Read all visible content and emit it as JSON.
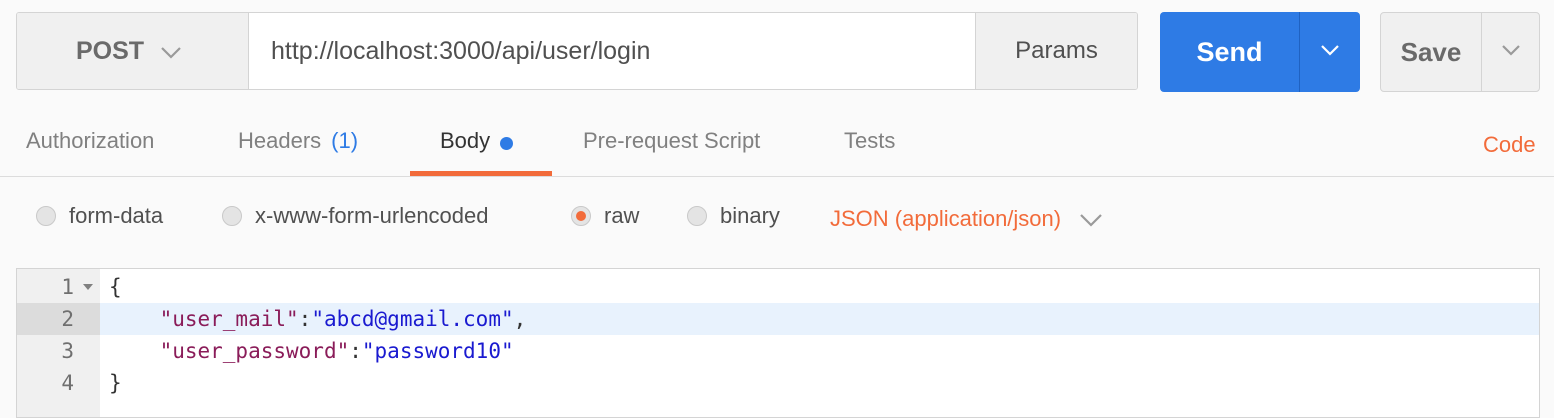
{
  "request": {
    "method": "POST",
    "url": "http://localhost:3000/api/user/login",
    "params_label": "Params",
    "send_label": "Send",
    "save_label": "Save"
  },
  "tabs": [
    {
      "label": "Authorization"
    },
    {
      "label": "Headers",
      "count": "(1)"
    },
    {
      "label": "Body",
      "active": true,
      "indicator": "blue-dot"
    },
    {
      "label": "Pre-request Script"
    },
    {
      "label": "Tests"
    }
  ],
  "code_link": "Code",
  "body_modes": [
    {
      "label": "form-data",
      "selected": false
    },
    {
      "label": "x-www-form-urlencoded",
      "selected": false
    },
    {
      "label": "raw",
      "selected": true
    },
    {
      "label": "binary",
      "selected": false
    }
  ],
  "content_type": "JSON (application/json)",
  "editor": {
    "active_line": 2,
    "lines": [
      {
        "num": "1",
        "open": "{"
      },
      {
        "num": "2",
        "indent": "    ",
        "key": "\"user_mail\"",
        "sep": ":",
        "value": "\"abcd@gmail.com\"",
        "trail": ","
      },
      {
        "num": "3",
        "indent": "    ",
        "key": "\"user_password\"",
        "sep": ":",
        "value": "\"password10\"",
        "trail": ""
      },
      {
        "num": "4",
        "close": "}"
      }
    ]
  },
  "colors": {
    "accent": "#f26b3a",
    "send_button": "#2e7be5",
    "json_key": "#8a1c59",
    "json_string": "#1a1ad0"
  },
  "icons": {
    "method_dropdown": "chevron-down-icon",
    "send_dropdown": "chevron-down-icon",
    "save_dropdown": "chevron-down-icon",
    "content_type_dropdown": "chevron-down-icon",
    "fold": "fold-arrow-icon"
  }
}
